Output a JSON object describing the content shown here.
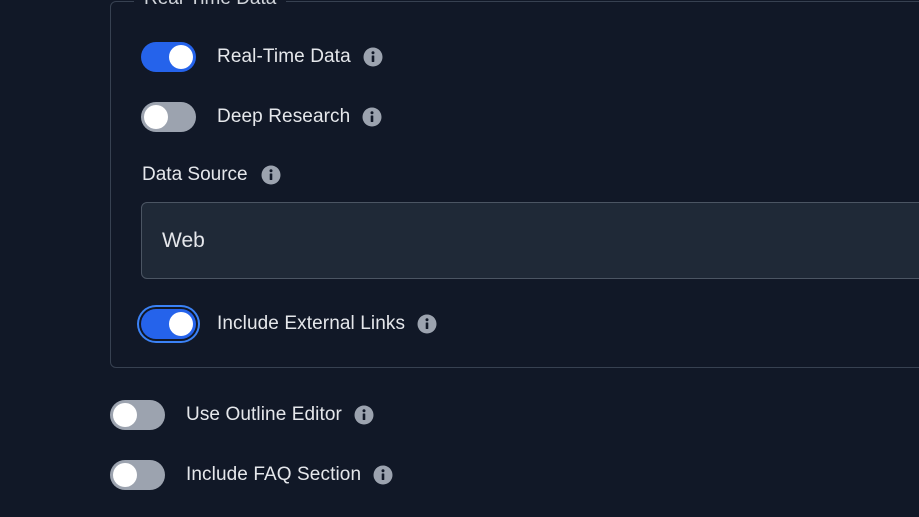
{
  "section": {
    "legend": "Real-Time Data"
  },
  "toggles": {
    "real_time_data": {
      "label": "Real-Time Data",
      "state": "on"
    },
    "deep_research": {
      "label": "Deep Research",
      "state": "off"
    },
    "include_external_links": {
      "label": "Include External Links",
      "state": "on"
    },
    "use_outline_editor": {
      "label": "Use Outline Editor",
      "state": "off"
    },
    "include_faq_section": {
      "label": "Include FAQ Section",
      "state": "off"
    }
  },
  "data_source": {
    "label": "Data Source",
    "value": "Web"
  },
  "colors": {
    "background": "#111827",
    "toggle_on": "#2563eb",
    "toggle_off": "#9ca3af",
    "border": "#374151",
    "select_bg": "#1f2937"
  },
  "icons": {
    "info": "info-circle-icon"
  }
}
